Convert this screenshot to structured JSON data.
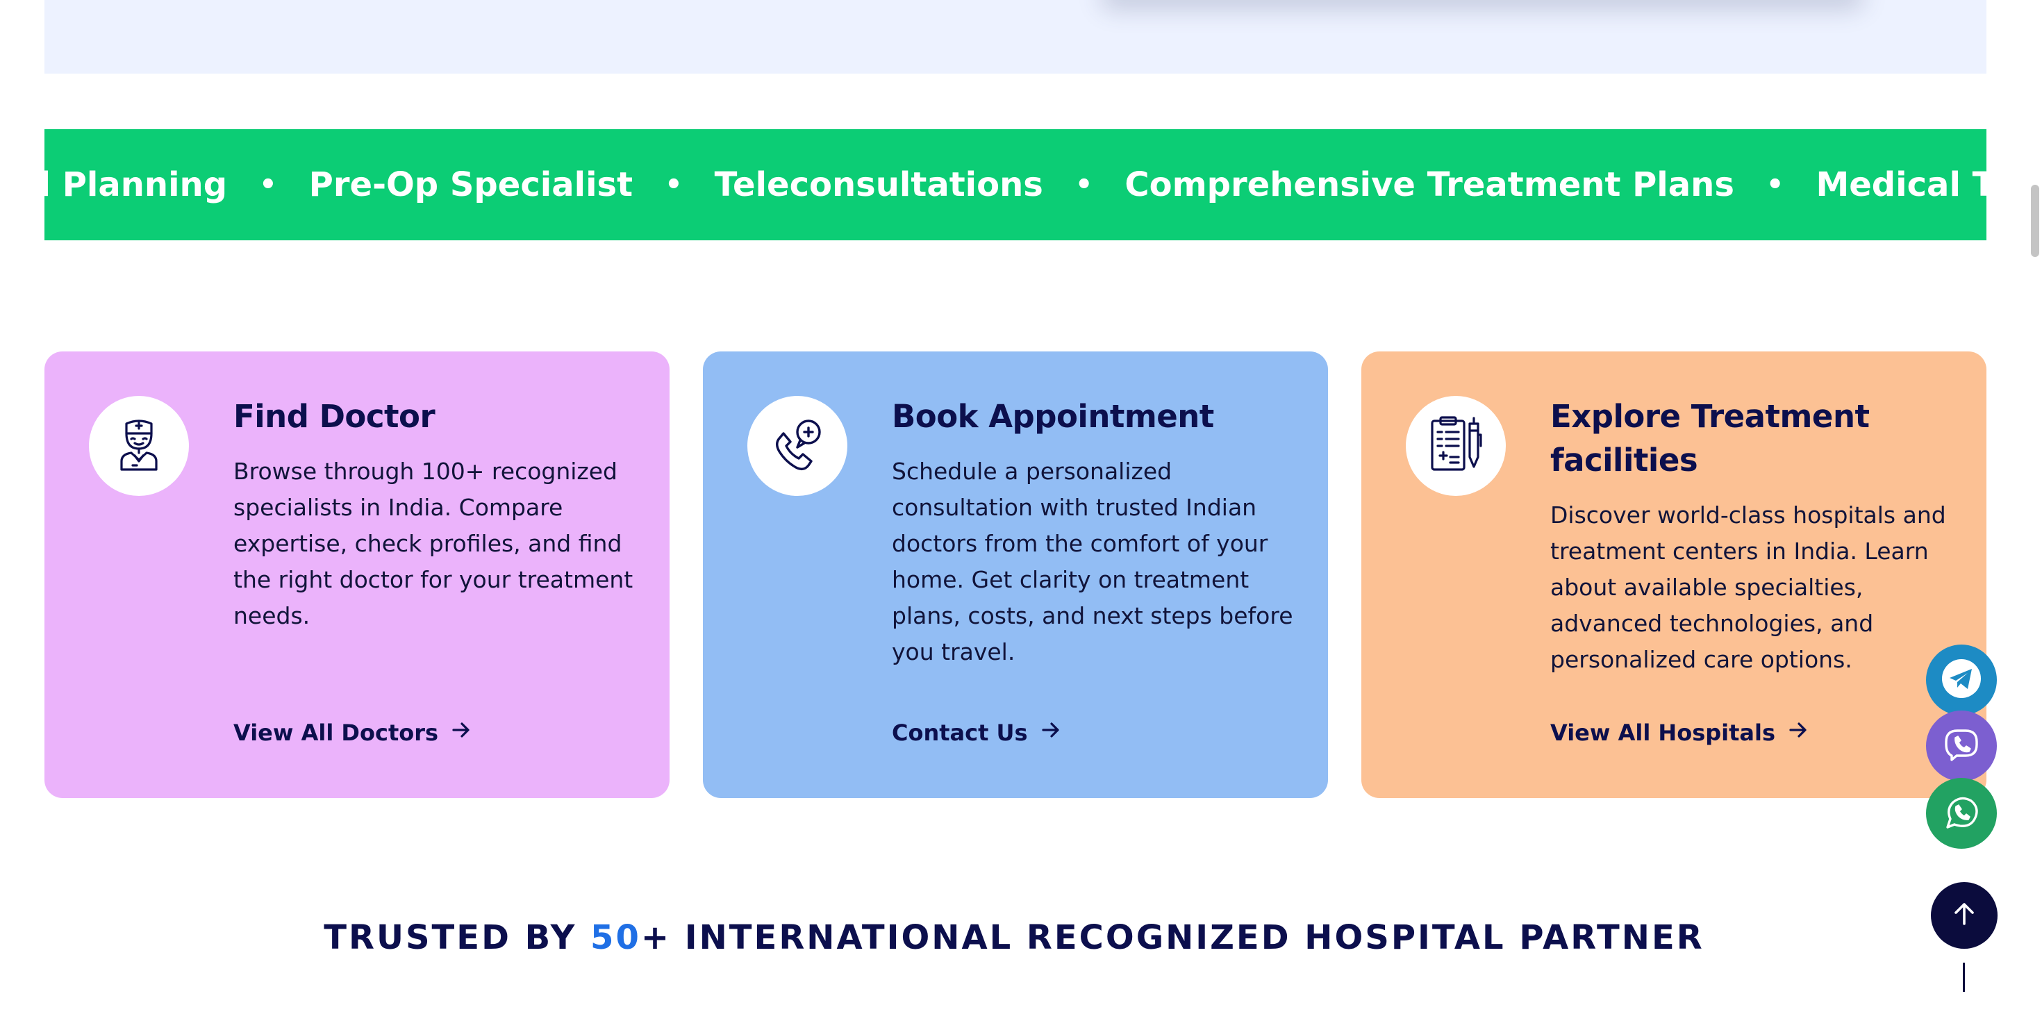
{
  "colors": {
    "marquee_bg": "#0ccd75",
    "navy": "#0c0f4d",
    "accent_blue": "#1f6fe5",
    "card_find_doctor": "#ebb3fb",
    "card_book_appointment": "#92bdf4",
    "card_explore_treatment": "#fcc194",
    "telegram": "#1d8bc4",
    "viber": "#7c5fd0",
    "whatsapp": "#22a262"
  },
  "marquee": {
    "separator": "•",
    "items": [
      "el Planning",
      "Pre-Op Specialist",
      "Teleconsultations",
      "Comprehensive Treatment Plans",
      "Medical Travel Planning"
    ]
  },
  "cards": [
    {
      "icon": "doctor-icon",
      "title": "Find Doctor",
      "description": "Browse through 100+ recognized specialists in India. Compare expertise, check profiles, and find the right doctor for your treatment needs.",
      "link": "View All Doctors"
    },
    {
      "icon": "phone-plus-icon",
      "title": "Book Appointment",
      "description": "Schedule a personalized consultation with trusted Indian doctors from the comfort of your home. Get clarity on treatment plans, costs, and next steps before you travel.",
      "link": "Contact Us"
    },
    {
      "icon": "clipboard-pen-icon",
      "title": "Explore Treatment facilities",
      "description": "Discover world-class hospitals and treatment centers in India. Learn about available specialties, advanced technologies, and personalized care options.",
      "link": "View All Hospitals"
    }
  ],
  "floating_buttons": [
    {
      "icon": "telegram-icon"
    },
    {
      "icon": "viber-icon"
    },
    {
      "icon": "whatsapp-icon"
    },
    {
      "icon": "arrow-up-icon"
    }
  ],
  "trusted": {
    "prefix": "TRUSTED BY ",
    "number": "50",
    "suffix": "+ INTERNATIONAL RECOGNIZED HOSPITAL PARTNER"
  }
}
